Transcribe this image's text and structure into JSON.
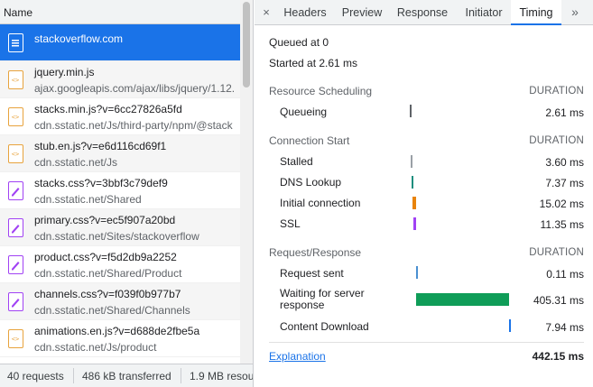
{
  "left": {
    "header_name": "Name",
    "requests": [
      {
        "name": "stackoverflow.com",
        "domain": "",
        "icon": "document-icon",
        "selected": true
      },
      {
        "name": "jquery.min.js",
        "domain": "ajax.googleapis.com/ajax/libs/jquery/1.12.",
        "icon": "script-icon"
      },
      {
        "name": "stacks.min.js?v=6cc27826a5fd",
        "domain": "cdn.sstatic.net/Js/third-party/npm/@stack",
        "icon": "script-icon"
      },
      {
        "name": "stub.en.js?v=e6d116cd69f1",
        "domain": "cdn.sstatic.net/Js",
        "icon": "script-icon"
      },
      {
        "name": "stacks.css?v=3bbf3c79def9",
        "domain": "cdn.sstatic.net/Shared",
        "icon": "stylesheet-icon"
      },
      {
        "name": "primary.css?v=ec5f907a20bd",
        "domain": "cdn.sstatic.net/Sites/stackoverflow",
        "icon": "stylesheet-icon"
      },
      {
        "name": "product.css?v=f5d2db9a2252",
        "domain": "cdn.sstatic.net/Shared/Product",
        "icon": "stylesheet-icon"
      },
      {
        "name": "channels.css?v=f039f0b977b7",
        "domain": "cdn.sstatic.net/Shared/Channels",
        "icon": "stylesheet-icon"
      },
      {
        "name": "animations.en.js?v=d688de2fbe5a",
        "domain": "cdn.sstatic.net/Js/product",
        "icon": "script-icon"
      }
    ],
    "status": {
      "requests": "40 requests",
      "transferred": "486 kB transferred",
      "resources": "1.9 MB resou"
    }
  },
  "tabs": {
    "close": "×",
    "items": [
      "Headers",
      "Preview",
      "Response",
      "Initiator",
      "Timing"
    ],
    "active": "Timing",
    "more": "»"
  },
  "timing": {
    "queued_at": "Queued at 0",
    "started_at": "Started at 2.61 ms",
    "duration_label": "DURATION",
    "sections": [
      {
        "title": "Resource Scheduling",
        "rows": [
          {
            "label": "Queueing",
            "value": "2.61 ms",
            "color": "#5f6368",
            "start_fraction": 0.0,
            "fraction": 0.006
          }
        ]
      },
      {
        "title": "Connection Start",
        "rows": [
          {
            "label": "Stalled",
            "value": "3.60 ms",
            "color": "#9aa0a6",
            "start_fraction": 0.006,
            "fraction": 0.008
          },
          {
            "label": "DNS Lookup",
            "value": "7.37 ms",
            "color": "#1e8e7e",
            "start_fraction": 0.014,
            "fraction": 0.017
          },
          {
            "label": "Initial connection",
            "value": "15.02 ms",
            "color": "#e8830c",
            "start_fraction": 0.031,
            "fraction": 0.034
          },
          {
            "label": "SSL",
            "value": "11.35 ms",
            "color": "#a142f4",
            "start_fraction": 0.039,
            "fraction": 0.026
          }
        ]
      },
      {
        "title": "Request/Response",
        "rows": [
          {
            "label": "Request sent",
            "value": "0.11 ms",
            "color": "#4a8fd1",
            "start_fraction": 0.065,
            "fraction": 0.001
          },
          {
            "label": "Waiting for server response",
            "value": "405.31 ms",
            "color": "#0f9d58",
            "start_fraction": 0.065,
            "fraction": 0.917
          },
          {
            "label": "Content Download",
            "value": "7.94 ms",
            "color": "#1a73e8",
            "start_fraction": 0.982,
            "fraction": 0.018
          }
        ]
      }
    ],
    "explanation": "Explanation",
    "total": "442.15 ms"
  }
}
